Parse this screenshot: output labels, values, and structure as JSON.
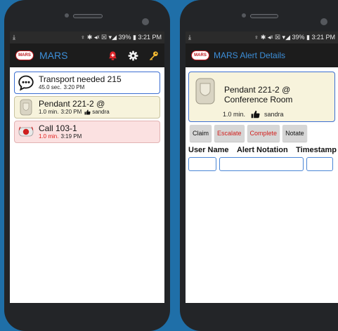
{
  "background_color": "#1f6fa8",
  "status_bar": {
    "left_icon": "download-icon",
    "indicators": "♀ ✱ ◂ᵡ ☒ ▾◢ 39% ▮",
    "time": "3:21 PM"
  },
  "left_screen": {
    "logo_text": "MARS",
    "title": "MARS",
    "header_icons": [
      "alarm-bell-icon",
      "gear-icon",
      "key-icon"
    ],
    "alerts": [
      {
        "title": "Transport needed 215",
        "elapsed": "45.0 sec.",
        "time": "3:20 PM",
        "user": "",
        "icon": "speech-bubble-icon",
        "elapsed_color": "#222222",
        "background": "#ffffff"
      },
      {
        "title": "Pendant 221-2 @",
        "elapsed": "1.0 min.",
        "time": "3:20 PM",
        "user": "sandra",
        "icon": "pendant-icon",
        "elapsed_color": "#222222",
        "background": "#f7f3dc"
      },
      {
        "title": "Call 103-1",
        "elapsed": "1.0 min.",
        "time": "3:19 PM",
        "user": "",
        "icon": "nurse-call-icon",
        "elapsed_color": "#e0201d",
        "background": "#fbe1e1"
      }
    ]
  },
  "right_screen": {
    "logo_text": "MARS",
    "title": "MARS Alert Details",
    "alert": {
      "title_line1": "Pendant 221-2 @",
      "title_line2": "Conference Room",
      "elapsed": "1.0 min.",
      "user": "sandra"
    },
    "buttons": {
      "claim": "Claim",
      "escalate": "Escalate",
      "complete": "Complete",
      "notate": "Notate"
    },
    "columns": {
      "user_name": "User Name",
      "alert_notation": "Alert Notation",
      "timestamp": "Timestamp"
    },
    "fields": {
      "user_name": "",
      "alert_notation": "",
      "timestamp": ""
    }
  }
}
